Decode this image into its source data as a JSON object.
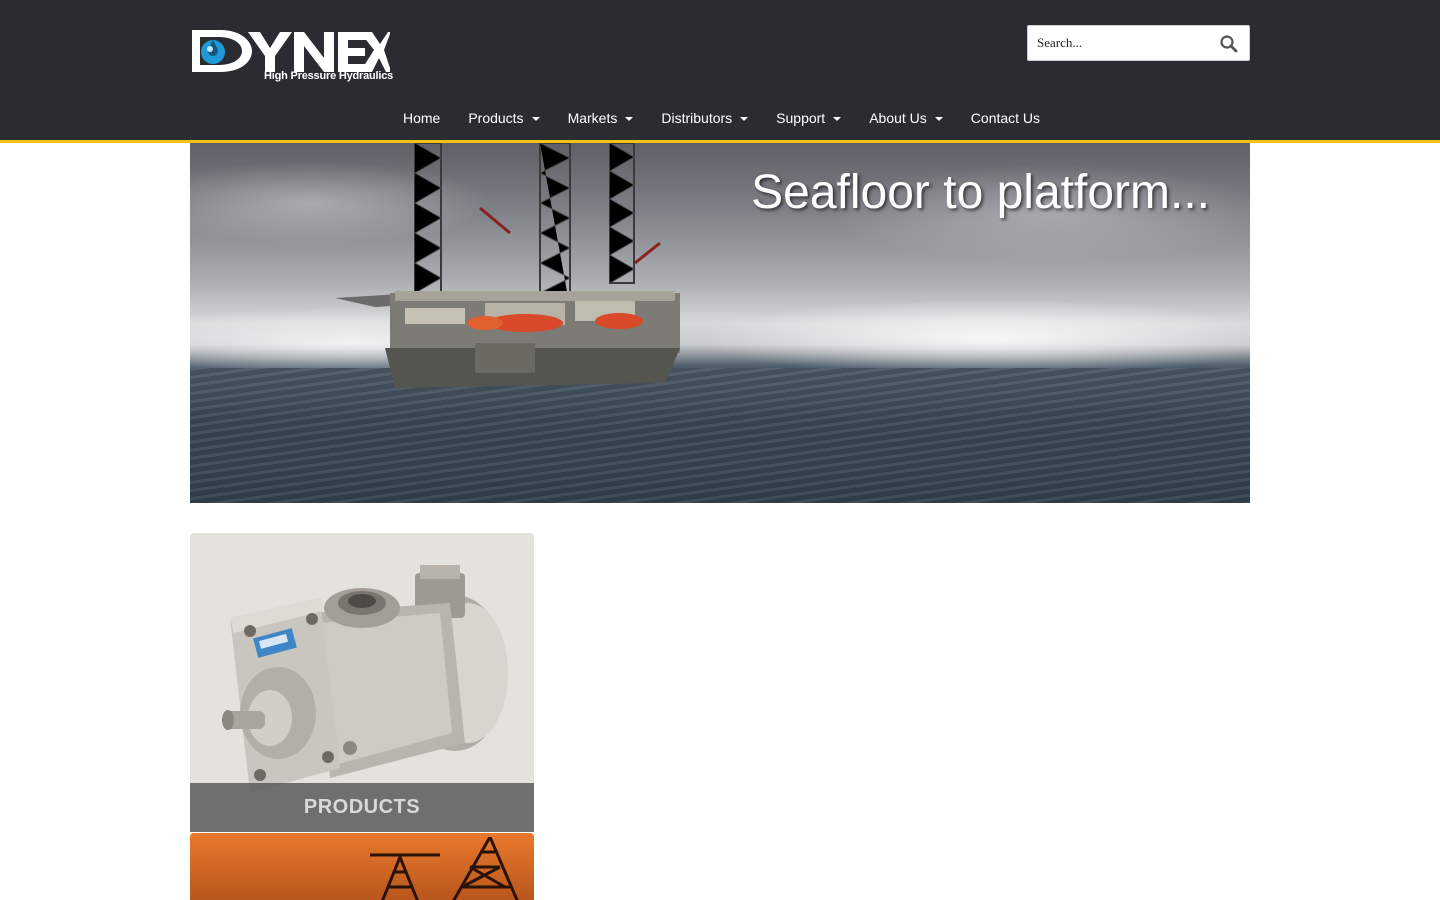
{
  "header": {
    "logo": {
      "wordmark": "DYNEX",
      "tagline": "High Pressure Hydraulics"
    },
    "search": {
      "placeholder": "Search...",
      "icon": "search-icon"
    }
  },
  "nav": {
    "items": [
      {
        "label": "Home",
        "has_dropdown": false
      },
      {
        "label": "Products",
        "has_dropdown": true
      },
      {
        "label": "Markets",
        "has_dropdown": true
      },
      {
        "label": "Distributors",
        "has_dropdown": true
      },
      {
        "label": "Support",
        "has_dropdown": true
      },
      {
        "label": "About Us",
        "has_dropdown": true
      },
      {
        "label": "Contact Us",
        "has_dropdown": false
      }
    ]
  },
  "hero": {
    "caption": "Seafloor to platform..."
  },
  "tiles": [
    {
      "label": "PRODUCTS"
    }
  ],
  "colors": {
    "header_bg": "#2b2c31",
    "accent_border": "#f2c314",
    "logo_blue": "#1e9ad6",
    "tile_label_bg": "#5f5f5f"
  }
}
